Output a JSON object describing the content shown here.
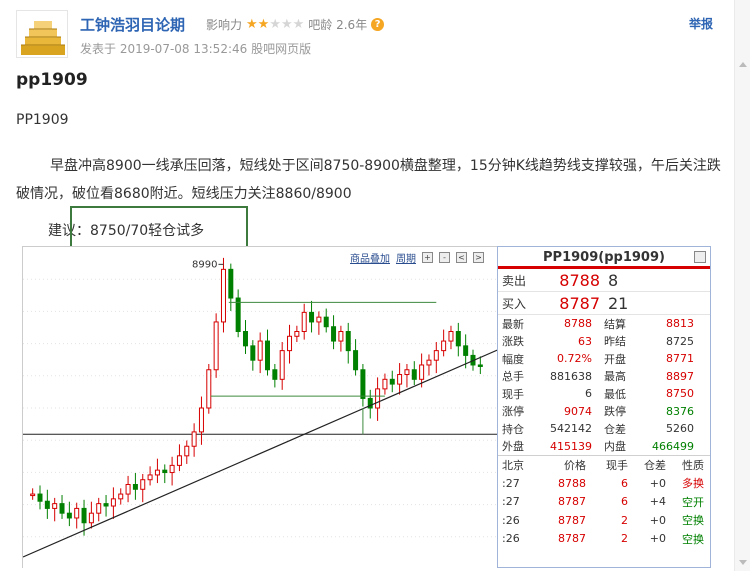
{
  "header": {
    "author": "工钟浩羽目论期",
    "influence_label": "影响力",
    "influence_stars": 2,
    "influence_max": 5,
    "age_label": "吧龄 2.6年",
    "posted": "发表于 2019-07-08 13:52:46 股吧网页版",
    "report": "举报"
  },
  "post": {
    "title": "pp1909",
    "subhead": "PP1909",
    "body": "早盘冲高8900一线承压回落，短线处于区间8750-8900横盘整理，15分钟K线趋势线支撑较强，午后关注跌破情况，破位看8680附近。短线压力关注8860/8900",
    "advice": "建议：8750/70轻仓试多"
  },
  "chart_data": {
    "type": "candlestick",
    "title": "",
    "annotations": [
      "8990"
    ],
    "peak_label": "8990",
    "resistance_level": 8900,
    "support_level": 8750,
    "series": [
      {
        "name": "",
        "values": [
          8520,
          8505,
          8490,
          8500,
          8480,
          8470,
          8490,
          8460,
          8480,
          8500,
          8495,
          8510,
          8520,
          8540,
          8530,
          8550,
          8560,
          8570,
          8565,
          8580,
          8600,
          8620,
          8650,
          8700,
          8780,
          8880,
          8990,
          8930,
          8860,
          8830,
          8800,
          8840,
          8780,
          8760,
          8820,
          8850,
          8860,
          8900,
          8880,
          8890,
          8870,
          8840,
          8860,
          8820,
          8780,
          8720,
          8700,
          8740,
          8760,
          8750,
          8770,
          8780,
          8760,
          8790,
          8800,
          8820,
          8840,
          8860,
          8830,
          8810,
          8790,
          8788
        ]
      }
    ]
  },
  "toolbar": {
    "overlay": "商品叠加",
    "period": "周期"
  },
  "quote": {
    "title": "PP1909(pp1909)",
    "sell_label": "卖出",
    "sell_price": "8788",
    "sell_vol": "8",
    "buy_label": "买入",
    "buy_price": "8787",
    "buy_vol": "21",
    "rows": [
      {
        "l1": "最新",
        "v1": "8788",
        "c1": "red",
        "l2": "结算",
        "v2": "8813",
        "c2": "red"
      },
      {
        "l1": "涨跌",
        "v1": "63",
        "c1": "red",
        "l2": "昨结",
        "v2": "8725",
        "c2": "black"
      },
      {
        "l1": "幅度",
        "v1": "0.72%",
        "c1": "red",
        "l2": "开盘",
        "v2": "8771",
        "c2": "red"
      },
      {
        "l1": "总手",
        "v1": "881638",
        "c1": "black",
        "l2": "最高",
        "v2": "8897",
        "c2": "red"
      },
      {
        "l1": "现手",
        "v1": "6",
        "c1": "black",
        "l2": "最低",
        "v2": "8750",
        "c2": "red"
      },
      {
        "l1": "涨停",
        "v1": "9074",
        "c1": "red",
        "l2": "跌停",
        "v2": "8376",
        "c2": "green"
      },
      {
        "l1": "持仓",
        "v1": "542142",
        "c1": "black",
        "l2": "仓差",
        "v2": "5260",
        "c2": "black"
      },
      {
        "l1": "外盘",
        "v1": "415139",
        "c1": "red",
        "l2": "内盘",
        "v2": "466499",
        "c2": "green"
      }
    ],
    "tick_header": [
      "北京",
      "价格",
      "现手",
      "仓差",
      "性质"
    ],
    "ticks": [
      {
        "t": ":27",
        "p": "8788",
        "q": "6",
        "d": "+0",
        "n": "多换",
        "nc": "red"
      },
      {
        "t": ":27",
        "p": "8787",
        "q": "6",
        "d": "+4",
        "n": "空开",
        "nc": "green"
      },
      {
        "t": ":26",
        "p": "8787",
        "q": "2",
        "d": "+0",
        "n": "空换",
        "nc": "green"
      },
      {
        "t": ":26",
        "p": "8787",
        "q": "2",
        "d": "+0",
        "n": "空换",
        "nc": "green"
      }
    ]
  }
}
